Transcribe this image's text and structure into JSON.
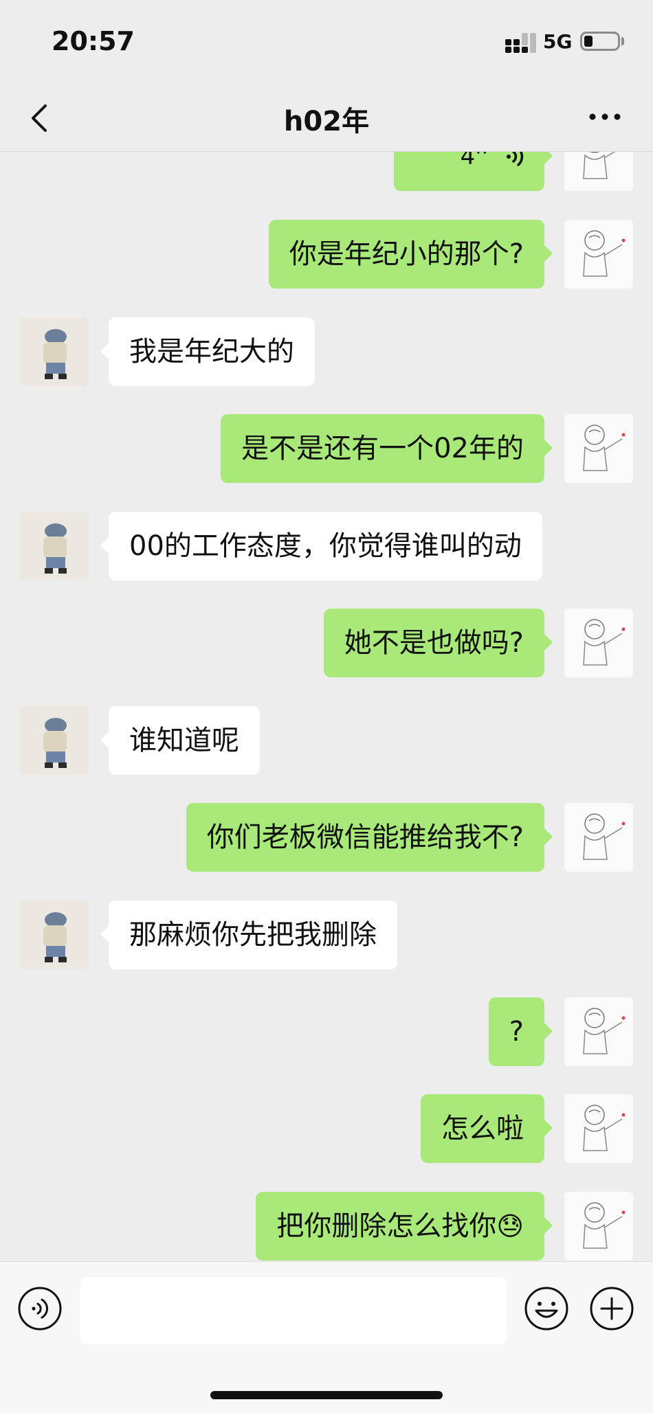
{
  "status_bar": {
    "time": "20:57",
    "network": "5G",
    "battery_level": 0.2
  },
  "header": {
    "title": "h02年",
    "back_icon": "chevron-left-icon",
    "more_icon": "ellipsis-icon"
  },
  "messages": [
    {
      "sender": "me",
      "type": "voice",
      "text": "4''"
    },
    {
      "sender": "me",
      "text": "你是年纪小的那个?"
    },
    {
      "sender": "other",
      "text": "我是年纪大的"
    },
    {
      "sender": "me",
      "text": "是不是还有一个02年的"
    },
    {
      "sender": "other",
      "text": "00的工作态度，你觉得谁叫的动"
    },
    {
      "sender": "me",
      "text": "她不是也做吗?"
    },
    {
      "sender": "other",
      "text": "谁知道呢"
    },
    {
      "sender": "me",
      "text": "你们老板微信能推给我不?"
    },
    {
      "sender": "other",
      "text": "那麻烦你先把我删除"
    },
    {
      "sender": "me",
      "text": "?"
    },
    {
      "sender": "me",
      "text": "怎么啦"
    },
    {
      "sender": "me",
      "text": "把你删除怎么找你",
      "emoji": "😓"
    }
  ],
  "input_bar": {
    "placeholder": "",
    "voice_icon": "voice-wave-icon",
    "emoji_icon": "smiley-icon",
    "plus_icon": "plus-circle-icon"
  },
  "colors": {
    "background": "#ededed",
    "my_bubble": "#a9e97a",
    "other_bubble": "#ffffff"
  }
}
